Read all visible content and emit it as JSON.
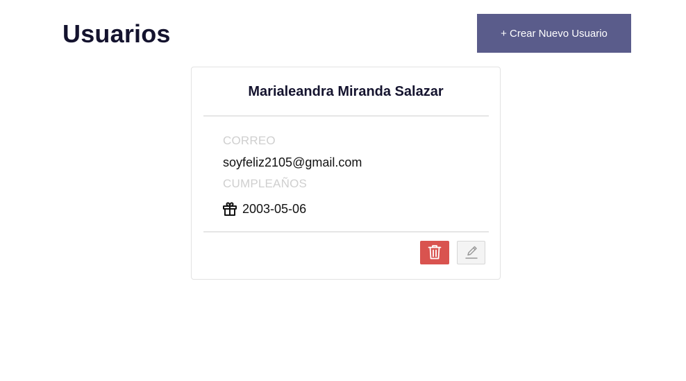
{
  "header": {
    "title": "Usuarios",
    "create_button_label": "+ Crear Nuevo Usuario"
  },
  "user_card": {
    "name": "Marialeandra Miranda Salazar",
    "email_label": "CORREO",
    "email": "soyfeliz2105@gmail.com",
    "birthday_label": "CUMPLEAÑOS",
    "birthday": "2003-05-06",
    "birthday_icon": "gift-icon",
    "delete_icon": "trash-icon",
    "edit_icon": "pencil-icon"
  },
  "colors": {
    "title": "#14132e",
    "primary_button": "#5a5c8b",
    "danger_button": "#d9534f",
    "label_muted": "#cfcfcf"
  }
}
